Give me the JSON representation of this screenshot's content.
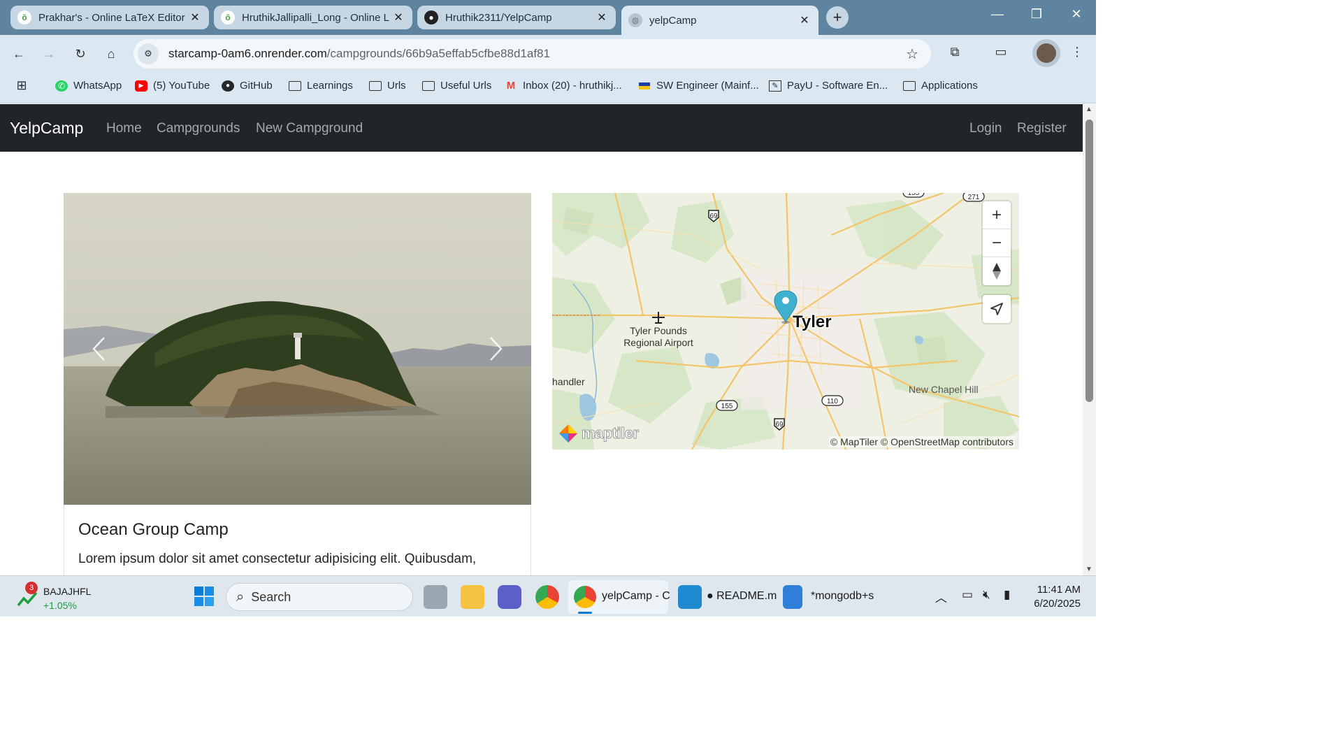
{
  "browser": {
    "tabs": [
      {
        "title": "Prakhar's - Online LaTeX Editor",
        "favicon": "overleaf-icon",
        "active": false
      },
      {
        "title": "HruthikJallipalli_Long - Online L",
        "favicon": "overleaf-icon",
        "active": false
      },
      {
        "title": "Hruthik2311/YelpCamp",
        "favicon": "github-icon",
        "active": false
      },
      {
        "title": "yelpCamp",
        "favicon": "globe-icon",
        "active": true
      }
    ],
    "url_host": "starcamp-0am6.onrender.com",
    "url_path": "/campgrounds/66b9a5effab5cfbe88d1af81",
    "bookmarks": [
      {
        "label": "WhatsApp",
        "icon": "whatsapp-icon"
      },
      {
        "label": "(5) YouTube",
        "icon": "youtube-icon"
      },
      {
        "label": "GitHub",
        "icon": "github-icon"
      },
      {
        "label": "Learnings",
        "icon": "folder-icon"
      },
      {
        "label": "Urls",
        "icon": "folder-icon"
      },
      {
        "label": "Useful Urls",
        "icon": "folder-icon"
      },
      {
        "label": "Inbox (20) - hruthikj...",
        "icon": "gmail-icon"
      },
      {
        "label": "SW Engineer (Mainf...",
        "icon": "flag-icon"
      },
      {
        "label": "PayU - Software En...",
        "icon": "pen-icon"
      },
      {
        "label": "Applications",
        "icon": "folder-icon"
      }
    ]
  },
  "app": {
    "brand": "YelpCamp",
    "nav": {
      "home": "Home",
      "campgrounds": "Campgrounds",
      "new": "New Campground",
      "login": "Login",
      "register": "Register"
    }
  },
  "campground": {
    "title": "Ocean Group Camp",
    "description": "Lorem ipsum dolor sit amet consectetur adipisicing elit. Quibusdam,"
  },
  "map": {
    "labels": {
      "city": "Tyler",
      "airport_line1": "Tyler Pounds",
      "airport_line2": "Regional Airport",
      "town_left": "handler",
      "town_right": "New Chapel Hill"
    },
    "shields": [
      "69",
      "155",
      "110",
      "69",
      "271",
      "155"
    ],
    "logo": "maptiler",
    "attribution": "© MapTiler © OpenStreetMap contributors"
  },
  "taskbar": {
    "stock_name": "BAJAJHFL",
    "stock_change": "+1.05%",
    "stock_badge": "3",
    "search_label": "Search",
    "chrome_label": "yelpCamp - C",
    "vscode_label": "● README.m",
    "notepad_label": "*mongodb+s",
    "time": "11:41 AM",
    "date": "6/20/2025"
  },
  "colors": {
    "navbar": "#212529",
    "tabstrip": "#5e84a0",
    "toolbar": "#dce8f1",
    "marker": "#3fb1ce"
  }
}
